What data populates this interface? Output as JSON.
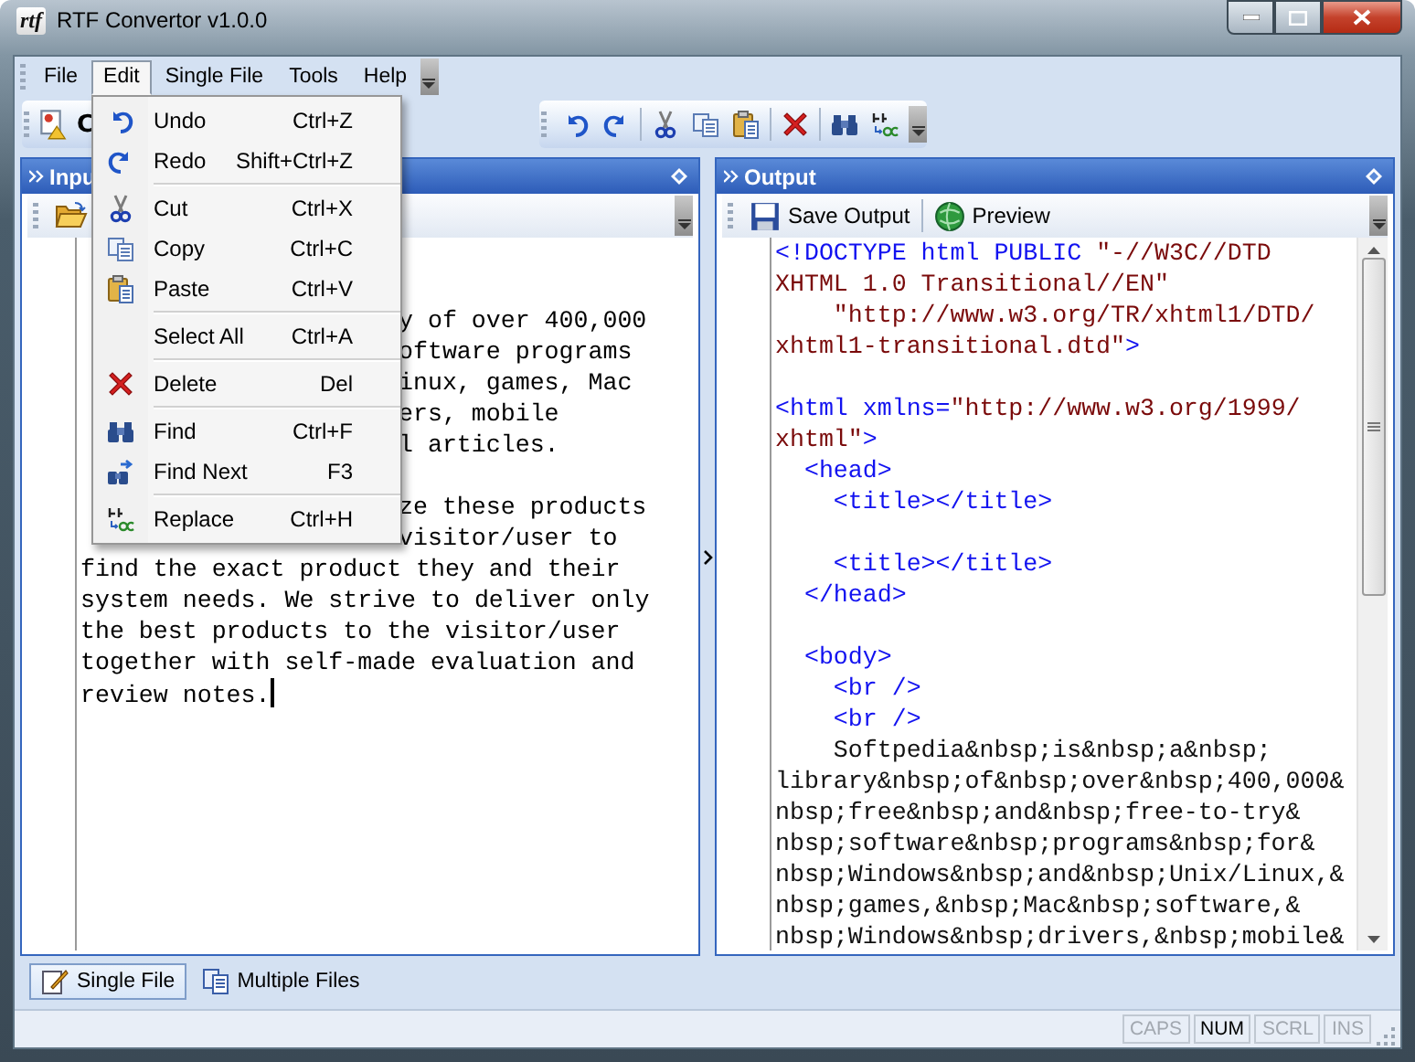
{
  "window": {
    "logo": "rtf",
    "title": "RTF Convertor v1.0.0"
  },
  "menubar": [
    {
      "label": "File",
      "selected": false
    },
    {
      "label": "Edit",
      "selected": true
    },
    {
      "label": "Single File",
      "selected": false
    },
    {
      "label": "Tools",
      "selected": false
    },
    {
      "label": "Help",
      "selected": false
    }
  ],
  "toolbar": {
    "convert_label": "C"
  },
  "edit_menu": [
    {
      "kind": "item",
      "label": "Undo",
      "shortcut": "Ctrl+Z"
    },
    {
      "kind": "item",
      "label": "Redo",
      "shortcut": "Shift+Ctrl+Z"
    },
    {
      "kind": "separator"
    },
    {
      "kind": "item",
      "label": "Cut",
      "shortcut": "Ctrl+X"
    },
    {
      "kind": "item",
      "label": "Copy",
      "shortcut": "Ctrl+C"
    },
    {
      "kind": "item",
      "label": "Paste",
      "shortcut": "Ctrl+V"
    },
    {
      "kind": "separator"
    },
    {
      "kind": "item",
      "label": "Select All",
      "shortcut": "Ctrl+A"
    },
    {
      "kind": "separator"
    },
    {
      "kind": "item",
      "label": "Delete",
      "shortcut": "Del"
    },
    {
      "kind": "separator"
    },
    {
      "kind": "item",
      "label": "Find",
      "shortcut": "Ctrl+F"
    },
    {
      "kind": "item",
      "label": "Find Next",
      "shortcut": "F3"
    },
    {
      "kind": "separator"
    },
    {
      "kind": "item",
      "label": "Replace",
      "shortcut": "Ctrl+H"
    }
  ],
  "input_panel": {
    "title": "Inpu",
    "lines": [
      {
        "kind": "blank"
      },
      {
        "kind": "blank"
      },
      {
        "kind": "covered",
        "end": "y of over 400,000"
      },
      {
        "kind": "covered",
        "end": "oftware programs"
      },
      {
        "kind": "covered",
        "end": "inux, games, Mac"
      },
      {
        "kind": "covered",
        "end": "ers, mobile"
      },
      {
        "kind": "covered",
        "end": "l articles."
      },
      {
        "kind": "blank"
      },
      {
        "kind": "covered",
        "end": "ze these products"
      },
      {
        "kind": "covered",
        "end": "visitor/user to"
      },
      {
        "kind": "full",
        "text": "find the exact product they and their"
      },
      {
        "kind": "full",
        "text": "system needs. We strive to deliver only"
      },
      {
        "kind": "full",
        "text": "the best products to the visitor/user"
      },
      {
        "kind": "full",
        "text": "together with self-made evaluation and"
      },
      {
        "kind": "full",
        "text": "review notes.",
        "cursor": true
      }
    ]
  },
  "output_panel": {
    "title": "Output",
    "buttons": [
      "Save Output",
      "Preview"
    ],
    "lines": [
      {
        "kind": "code",
        "segments": [
          {
            "kind": "tag",
            "text": "<!DOCTYPE html PUBLIC "
          },
          {
            "kind": "string",
            "text": "\"-//W3C//DTD"
          }
        ]
      },
      {
        "kind": "code",
        "segments": [
          {
            "kind": "string",
            "text": "XHTML 1.0 Transitional//EN\""
          }
        ]
      },
      {
        "kind": "code",
        "segments": [
          {
            "kind": "string",
            "text": "    \"http://www.w3.org/TR/xhtml1/DTD/"
          }
        ]
      },
      {
        "kind": "code",
        "segments": [
          {
            "kind": "string",
            "text": "xhtml1-transitional.dtd\""
          },
          {
            "kind": "tag",
            "text": ">"
          }
        ]
      },
      {
        "kind": "blank"
      },
      {
        "kind": "code",
        "segments": [
          {
            "kind": "tag",
            "text": "<html xmlns="
          },
          {
            "kind": "string",
            "text": "\"http://www.w3.org/1999/"
          }
        ]
      },
      {
        "kind": "code",
        "segments": [
          {
            "kind": "string",
            "text": "xhtml\""
          },
          {
            "kind": "tag",
            "text": ">"
          }
        ]
      },
      {
        "kind": "code",
        "segments": [
          {
            "kind": "tag",
            "text": "  <head>"
          }
        ]
      },
      {
        "kind": "code",
        "segments": [
          {
            "kind": "tag",
            "text": "    <title></title>"
          }
        ]
      },
      {
        "kind": "blank"
      },
      {
        "kind": "code",
        "segments": [
          {
            "kind": "tag",
            "text": "    <title></title>"
          }
        ]
      },
      {
        "kind": "code",
        "segments": [
          {
            "kind": "tag",
            "text": "  </head>"
          }
        ]
      },
      {
        "kind": "blank"
      },
      {
        "kind": "code",
        "segments": [
          {
            "kind": "tag",
            "text": "  <body>"
          }
        ]
      },
      {
        "kind": "code",
        "segments": [
          {
            "kind": "tag",
            "text": "    <br />"
          }
        ]
      },
      {
        "kind": "code",
        "segments": [
          {
            "kind": "tag",
            "text": "    <br />"
          }
        ]
      },
      {
        "kind": "code",
        "segments": [
          {
            "kind": "text",
            "text": "    Softpedia&nbsp;is&nbsp;a&nbsp;"
          }
        ]
      },
      {
        "kind": "code",
        "segments": [
          {
            "kind": "text",
            "text": "library&nbsp;of&nbsp;over&nbsp;400,000&"
          }
        ]
      },
      {
        "kind": "code",
        "segments": [
          {
            "kind": "text",
            "text": "nbsp;free&nbsp;and&nbsp;free-to-try&"
          }
        ]
      },
      {
        "kind": "code",
        "segments": [
          {
            "kind": "text",
            "text": "nbsp;software&nbsp;programs&nbsp;for&"
          }
        ]
      },
      {
        "kind": "code",
        "segments": [
          {
            "kind": "text",
            "text": "nbsp;Windows&nbsp;and&nbsp;Unix/Linux,&"
          }
        ]
      },
      {
        "kind": "code",
        "segments": [
          {
            "kind": "text",
            "text": "nbsp;games,&nbsp;Mac&nbsp;software,&"
          }
        ]
      },
      {
        "kind": "code",
        "segments": [
          {
            "kind": "text",
            "text": "nbsp;Windows&nbsp;drivers,&nbsp;mobile&"
          }
        ]
      }
    ]
  },
  "bottom_tabs": [
    {
      "label": "Single File",
      "selected": true
    },
    {
      "label": "Multiple Files",
      "selected": false
    }
  ],
  "status_bar": [
    {
      "label": "CAPS",
      "on": false
    },
    {
      "label": "NUM",
      "on": true
    },
    {
      "label": "SCRL",
      "on": false
    },
    {
      "label": "INS",
      "on": false
    }
  ]
}
